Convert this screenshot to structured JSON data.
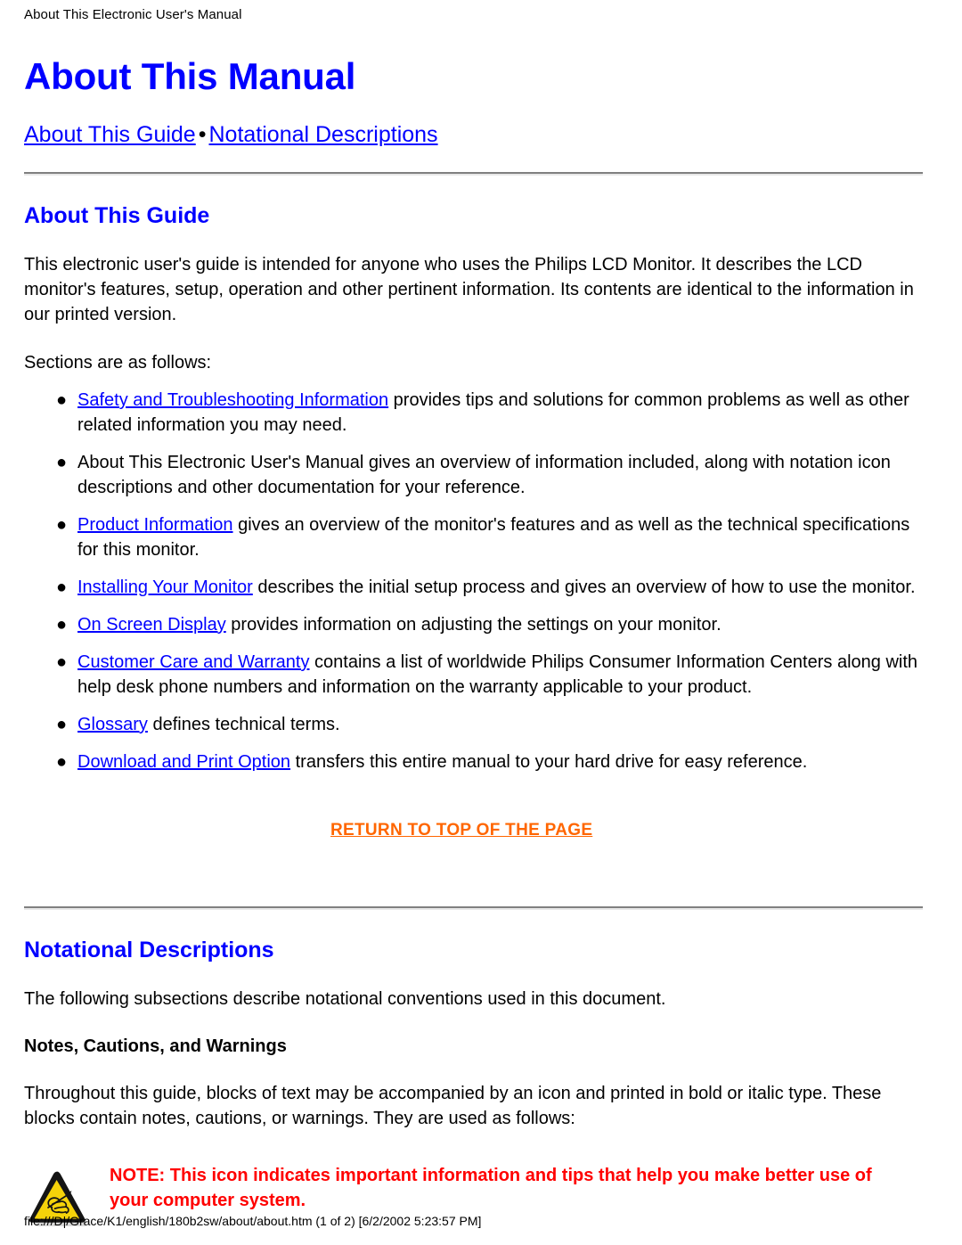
{
  "page_header": "About This Electronic User's Manual",
  "doc_title": "About This Manual",
  "nav": {
    "link1": "About This Guide",
    "separator": "•",
    "link2": "Notational Descriptions"
  },
  "guide_section": {
    "heading": "About This Guide",
    "intro": "This electronic user's guide is intended for anyone who uses the Philips LCD Monitor. It describes the LCD monitor's features, setup, operation and other pertinent information. Its contents are identical to the information in our printed version.",
    "sections_lead": "Sections are as follows:",
    "items": [
      {
        "bullet": "●",
        "link": "Safety and Troubleshooting Information",
        "rest": " provides tips and solutions for common problems as well as other related information you may need."
      },
      {
        "bullet": "●",
        "link": "",
        "rest": "About This Electronic User's Manual gives an overview of information included, along with notation icon descriptions and other documentation for your reference."
      },
      {
        "bullet": "●",
        "link": "Product Information",
        "rest": " gives an overview of the monitor's features and as well as the technical specifications for this monitor."
      },
      {
        "bullet": "●",
        "link": "Installing Your Monitor",
        "rest": " describes the initial setup process and gives an overview of how to use the monitor."
      },
      {
        "bullet": "●",
        "link": "On Screen Display",
        "rest": " provides information on adjusting the settings on your monitor."
      },
      {
        "bullet": "●",
        "link": "Customer Care and Warranty",
        "rest": " contains a list of worldwide Philips Consumer Information Centers along with help desk phone numbers and information on the warranty applicable to your product."
      },
      {
        "bullet": "●",
        "link": "Glossary",
        "rest": " defines technical terms."
      },
      {
        "bullet": "●",
        "link": "Download and Print Option",
        "rest": " transfers this entire manual to your hard drive for easy reference."
      }
    ],
    "return_to_top": "RETURN TO TOP OF THE PAGE"
  },
  "notational_section": {
    "heading": "Notational Descriptions",
    "intro": "The following subsections describe notational conventions used in this document.",
    "sub_heading": "Notes, Cautions, and Warnings",
    "body": "Throughout this guide, blocks of text may be accompanied by an icon and printed in bold or italic type. These blocks contain notes, cautions, or warnings. They are used as follows:",
    "note": {
      "icon": "note-warning-triangle-icon",
      "text": "NOTE: This icon indicates important information and tips that help you make better use of your computer system."
    }
  },
  "footer": "file:///D|/Grace/K1/english/180b2sw/about/about.htm (1 of 2) [6/2/2002 5:23:57 PM]",
  "colors": {
    "heading_blue": "#0000ff",
    "link_blue": "#0000ff",
    "return_orange": "#ff6600",
    "note_red": "#ff0000",
    "icon_yellow": "#f5d30a",
    "icon_border": "#1a1a1a",
    "rule_dark": "#808080",
    "rule_light": "#e8e8e8"
  }
}
